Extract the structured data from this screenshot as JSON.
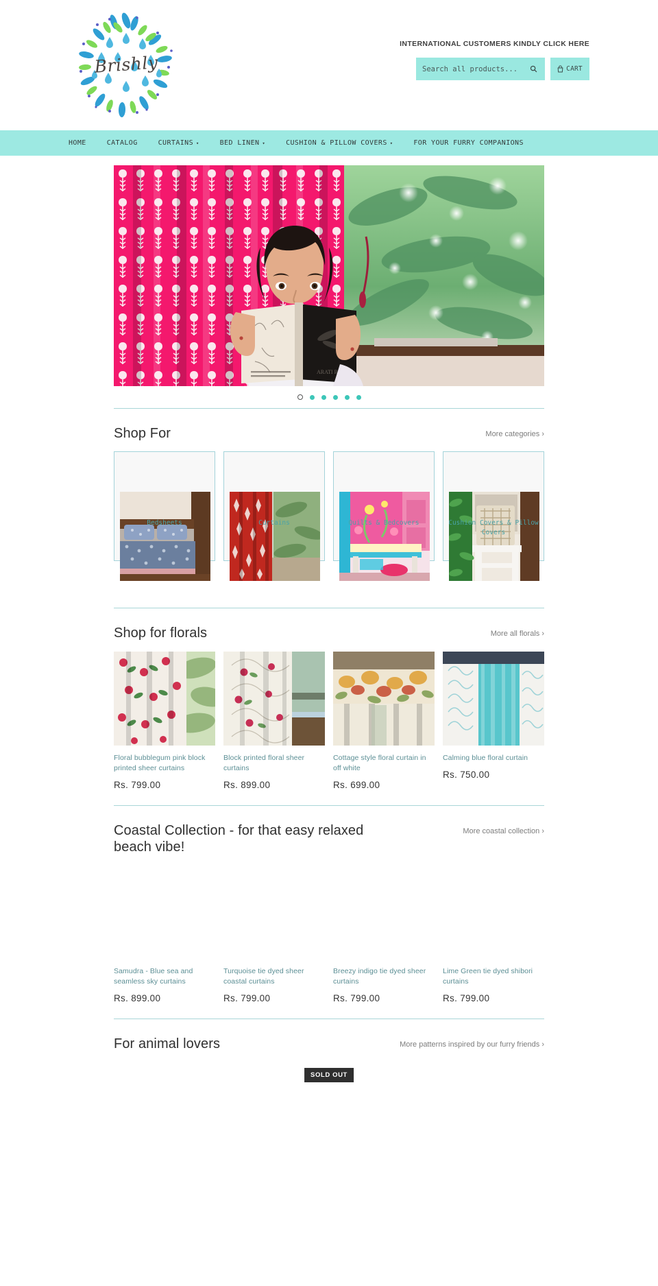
{
  "brand": {
    "name": "Brishly"
  },
  "header": {
    "intl_link": "INTERNATIONAL CUSTOMERS KINDLY CLICK HERE",
    "search_placeholder": "Search all products...",
    "search_value": "",
    "cart_label": "CART"
  },
  "nav": {
    "items": [
      {
        "label": "HOME",
        "caret": ""
      },
      {
        "label": "CATALOG",
        "caret": ""
      },
      {
        "label": "CURTAINS",
        "caret": "▾"
      },
      {
        "label": "BED LINEN",
        "caret": "▾"
      },
      {
        "label": "CUSHION & PILLOW COVERS",
        "caret": "▾"
      },
      {
        "label": "FOR YOUR FURRY COMPANIONS",
        "caret": ""
      }
    ]
  },
  "hero": {
    "slides_count": 6,
    "active_index": 0
  },
  "shop_for": {
    "title": "Shop For",
    "more": "More categories ›",
    "categories": [
      {
        "label": "Bedsheets"
      },
      {
        "label": "Curtains"
      },
      {
        "label": "Quilts & Bedcovers"
      },
      {
        "label": "Cushion Covers & Pillow Covers"
      }
    ]
  },
  "florals": {
    "title": "Shop for florals",
    "more": "More all florals ›",
    "products": [
      {
        "title": "Floral bubblegum pink block printed sheer curtains",
        "price": "Rs. 799.00"
      },
      {
        "title": "Block printed floral sheer curtains",
        "price": "Rs. 899.00"
      },
      {
        "title": "Cottage style floral curtain in off white",
        "price": "Rs. 699.00"
      },
      {
        "title": "Calming blue floral curtain",
        "price": "Rs. 750.00"
      }
    ]
  },
  "coastal": {
    "title": "Coastal Collection - for that easy relaxed beach vibe!",
    "more": "More coastal collection ›",
    "products": [
      {
        "title": "Samudra - Blue sea and seamless sky curtains",
        "price": "Rs. 899.00"
      },
      {
        "title": "Turquoise tie dyed sheer coastal curtains",
        "price": "Rs. 799.00"
      },
      {
        "title": "Breezy indigo tie dyed sheer curtains",
        "price": "Rs. 799.00"
      },
      {
        "title": "Lime Green tie dyed shibori curtains",
        "price": "Rs. 799.00"
      }
    ]
  },
  "animal_lovers": {
    "title": "For animal lovers",
    "more": "More patterns inspired by our furry friends ›",
    "badge": "SOLD OUT"
  },
  "colors": {
    "teal": "#9ae8e0",
    "nav_teal": "#9de9e2",
    "link": "#5b8e94",
    "rule": "#a9d6d8",
    "dot": "#3dc6b8"
  }
}
